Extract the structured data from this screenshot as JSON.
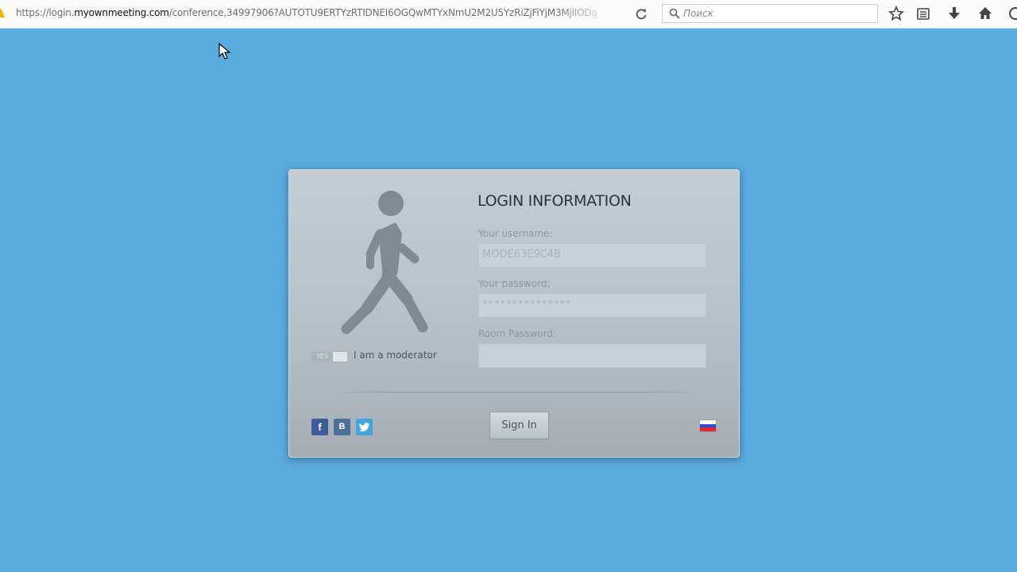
{
  "browser": {
    "url_prefix": "https://login.",
    "url_host": "myownmeeting.com",
    "url_path": "/conference,34997906?AUTOTU9ERTYzRTIDNEI6OGQwMTYxNmU2M2U5YzRiZjFiYjM3MjlIODg",
    "search_placeholder": "Поиск"
  },
  "login": {
    "title": "LOGIN INFORMATION",
    "username_label": "Your username:",
    "username_value": "MODE63E9C4B",
    "password_label": "Your password:",
    "password_value": "***************",
    "room_password_label": "Room Password:",
    "room_password_value": "",
    "moderator_toggle_text": "YES",
    "moderator_label": "I am a moderator",
    "sign_in_label": "Sign In",
    "social": {
      "facebook": "f",
      "vk": "B",
      "twitter": "twitter-bird-icon"
    },
    "flag_colors": [
      "#ffffff",
      "#2d4fd6",
      "#e3262e"
    ]
  }
}
